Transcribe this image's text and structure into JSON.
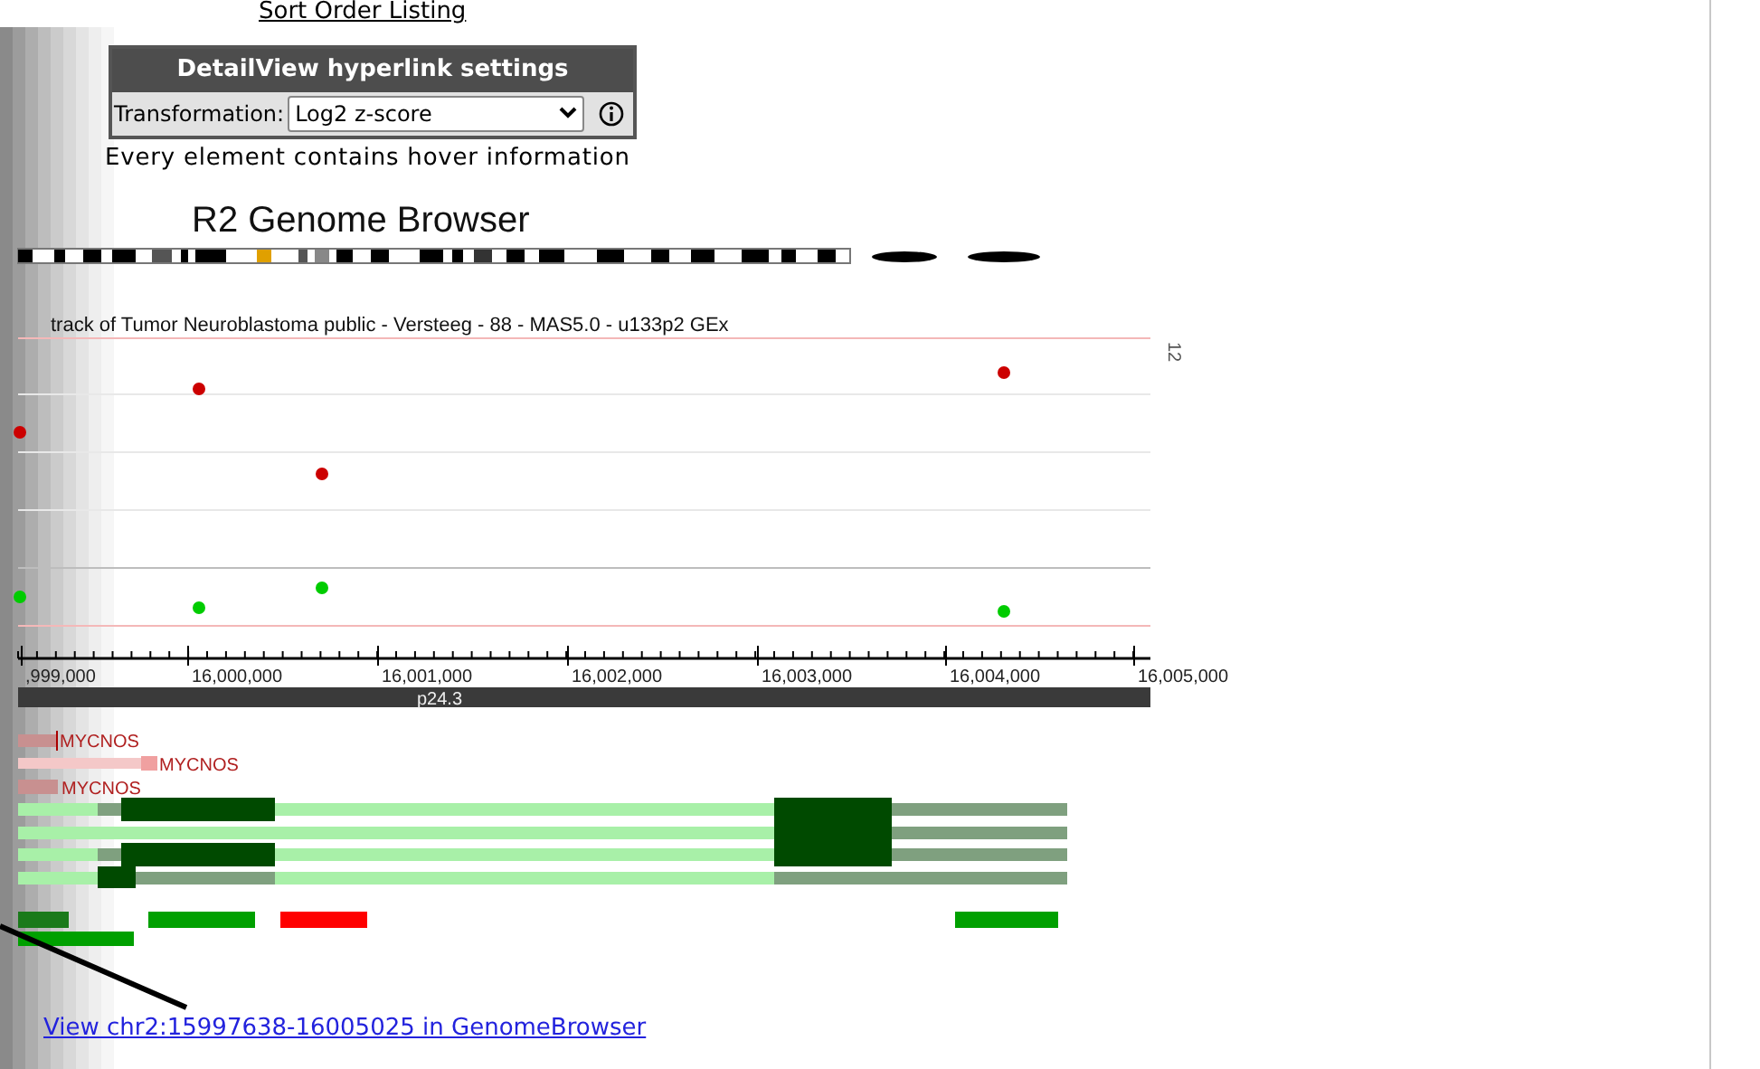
{
  "sort_link": "Sort Order Listing",
  "settings_panel": {
    "title": "DetailView hyperlink settings",
    "label": "Transformation:",
    "select_value": "Log2 z-score"
  },
  "hover_note": "Every element contains hover information",
  "browser": {
    "title": "R2 Genome Browser",
    "track_title": "track of Tumor Neuroblastoma public - Versteeg - 88 - MAS5.0 - u133p2 GEx",
    "scale_label": "12",
    "x_ticks": [
      ",999,000",
      "16,000,000",
      "16,001,000",
      "16,002,000",
      "16,003,000",
      "16,004,000",
      "16,005,000"
    ],
    "band": "p24.3",
    "gene_labels": [
      "MYCNOS",
      "MYCNOS",
      "MYCNOS"
    ]
  },
  "genome_link": "View chr2:15997638-16005025 in GenomeBrowser"
}
